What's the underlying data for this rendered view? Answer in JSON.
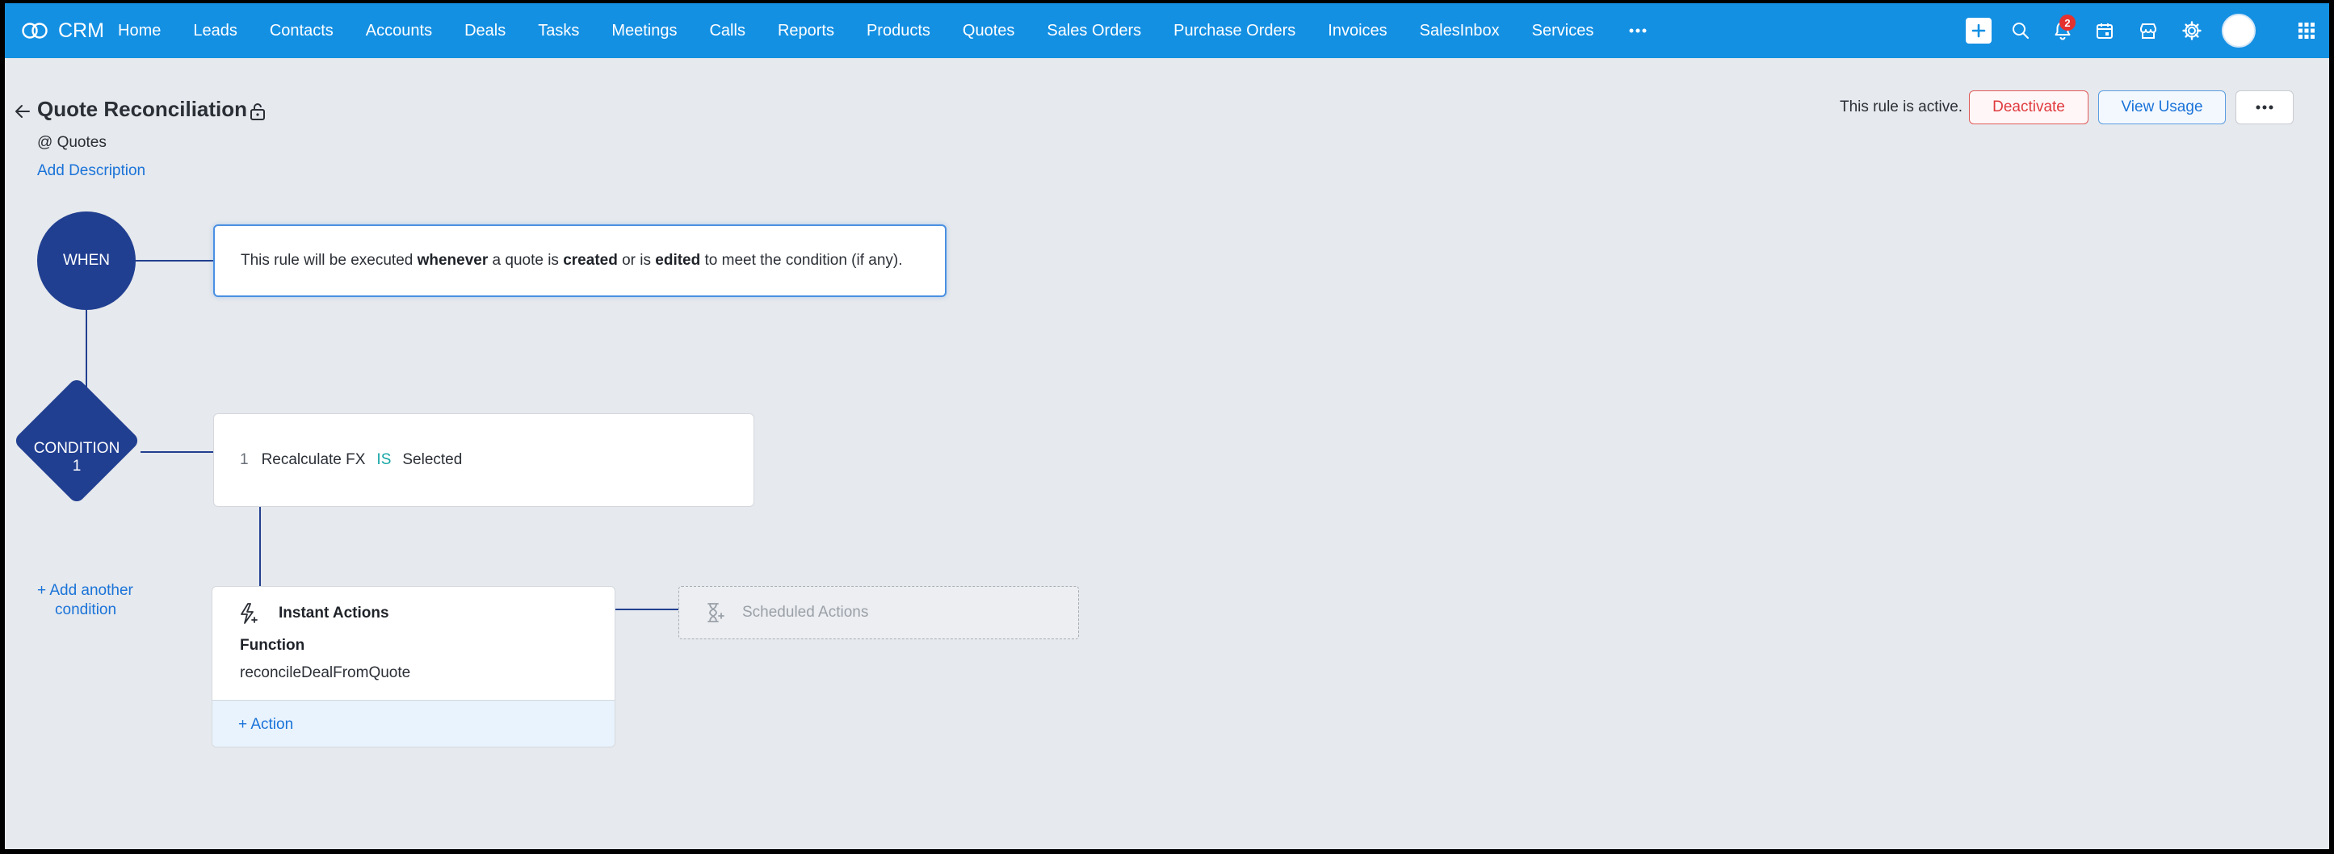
{
  "app": {
    "name": "CRM"
  },
  "nav": {
    "items": [
      "Home",
      "Leads",
      "Contacts",
      "Accounts",
      "Deals",
      "Tasks",
      "Meetings",
      "Calls",
      "Reports",
      "Products",
      "Quotes",
      "Sales Orders",
      "Purchase Orders",
      "Invoices",
      "SalesInbox",
      "Services"
    ],
    "notification_count": "2"
  },
  "header": {
    "title": "Quote Reconciliation",
    "module": "@ Quotes",
    "add_description": "Add Description",
    "status_text": "This rule is active.",
    "deactivate_label": "Deactivate",
    "view_usage_label": "View Usage"
  },
  "flow": {
    "when_label": "WHEN",
    "when_text": {
      "p1": "This rule will be executed ",
      "b1": "whenever",
      "p2": " a quote is ",
      "b2": "created",
      "p3": " or is ",
      "b3": "edited",
      "p4": " to meet the condition (if any)."
    },
    "condition_label_line1": "CONDITION",
    "condition_label_line2": "1",
    "condition": {
      "number": "1",
      "field": "Recalculate FX",
      "operator": "IS",
      "value": "Selected"
    },
    "add_condition_line1": "+ Add another",
    "add_condition_line2": "condition",
    "instant_actions": {
      "title": "Instant Actions",
      "function_label": "Function",
      "function_name": "reconcileDealFromQuote",
      "add_action": "+ Action"
    },
    "scheduled_actions": {
      "title": "Scheduled Actions"
    }
  },
  "icons": {
    "logo": "crm-logo-icon",
    "plus": "plus-icon",
    "search": "search-icon",
    "bell": "bell-icon",
    "calendar": "calendar-icon",
    "store": "marketplace-icon",
    "settings": "gear-icon",
    "apps": "apps-grid-icon",
    "back": "back-arrow-icon",
    "lock": "lock-icon",
    "bolt": "lightning-icon",
    "hourglass": "hourglass-icon"
  },
  "colors": {
    "topbar": "#1490e3",
    "node": "#213f91",
    "link": "#1a73d9",
    "danger": "#e0393e",
    "operator": "#18a6a6"
  }
}
